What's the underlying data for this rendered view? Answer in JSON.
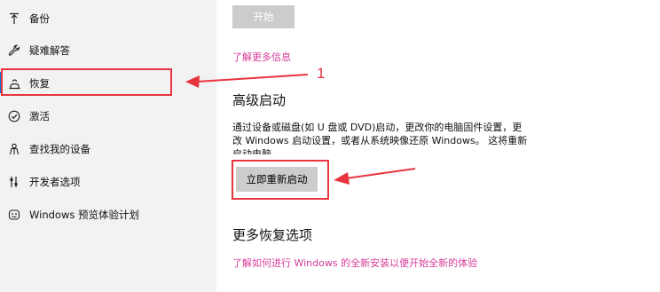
{
  "sidebar": {
    "items": [
      {
        "label": "备份",
        "icon": "backup-arrow-icon",
        "selected": false
      },
      {
        "label": "疑难解答",
        "icon": "wrench-icon",
        "selected": false
      },
      {
        "label": "恢复",
        "icon": "recovery-icon",
        "selected": true
      },
      {
        "label": "激活",
        "icon": "check-circle-icon",
        "selected": false
      },
      {
        "label": "查找我的设备",
        "icon": "person-location-icon",
        "selected": false
      },
      {
        "label": "开发者选项",
        "icon": "developer-sliders-icon",
        "selected": false
      },
      {
        "label": "Windows 预览体验计划",
        "icon": "insider-smiley-icon",
        "selected": false
      }
    ]
  },
  "main": {
    "start_button_label": "开始",
    "learn_more_link": "了解更多信息",
    "advanced_startup": {
      "heading": "高级启动",
      "description_lines": [
        "通过设备或磁盘(如 U 盘或 DVD)启动，更改你的电脑固件设置，更",
        "改 Windows 启动设置，或者从系统映像还原 Windows。 这将重新",
        "启动电脑。"
      ],
      "restart_button_label": "立即重新启动"
    },
    "more_recovery": {
      "heading": "更多恢复选项",
      "link": "了解如何进行 Windows 的全新安装以便开始全新的体验"
    }
  },
  "annotations": {
    "marker_number": "1",
    "color": "#e8343f"
  },
  "colors": {
    "accent": "#0078d7",
    "link": "#d63a9b",
    "sidebar_bg": "#f2f2f2",
    "button_bg": "#cccccc"
  }
}
